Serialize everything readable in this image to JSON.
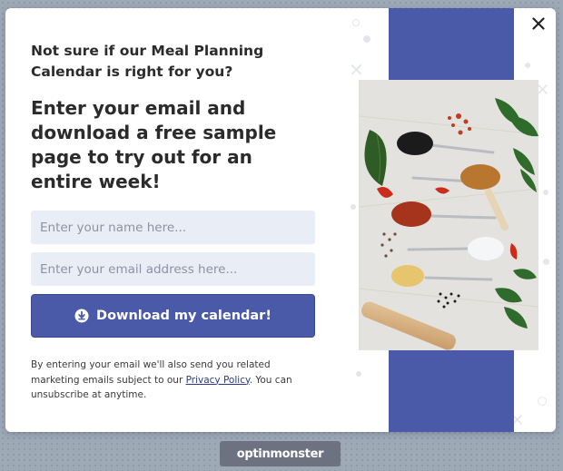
{
  "modal": {
    "question": "Not sure if our Meal Planning Calendar is right for you?",
    "headline": "Enter your email and download a free sample page to try out for an entire week!",
    "name_placeholder": "Enter your name here...",
    "email_placeholder": "Enter your email address here...",
    "cta_label": "Download my calendar!",
    "cta_icon": "download-circle-icon",
    "close_icon": "close-icon",
    "disclaimer_before": "By entering your email we'll also send you related marketing emails subject to our ",
    "privacy_link": "Privacy Policy",
    "disclaimer_after": ". You can unsubscribe at anytime."
  },
  "image": {
    "subject": "spice-spoons-photo"
  },
  "branding": {
    "badge_label": "optinmonster"
  },
  "colors": {
    "accent": "#4a5aa8",
    "field_bg": "#e9edf5",
    "badge_bg": "#6d7280",
    "text": "#2b2b2b"
  }
}
